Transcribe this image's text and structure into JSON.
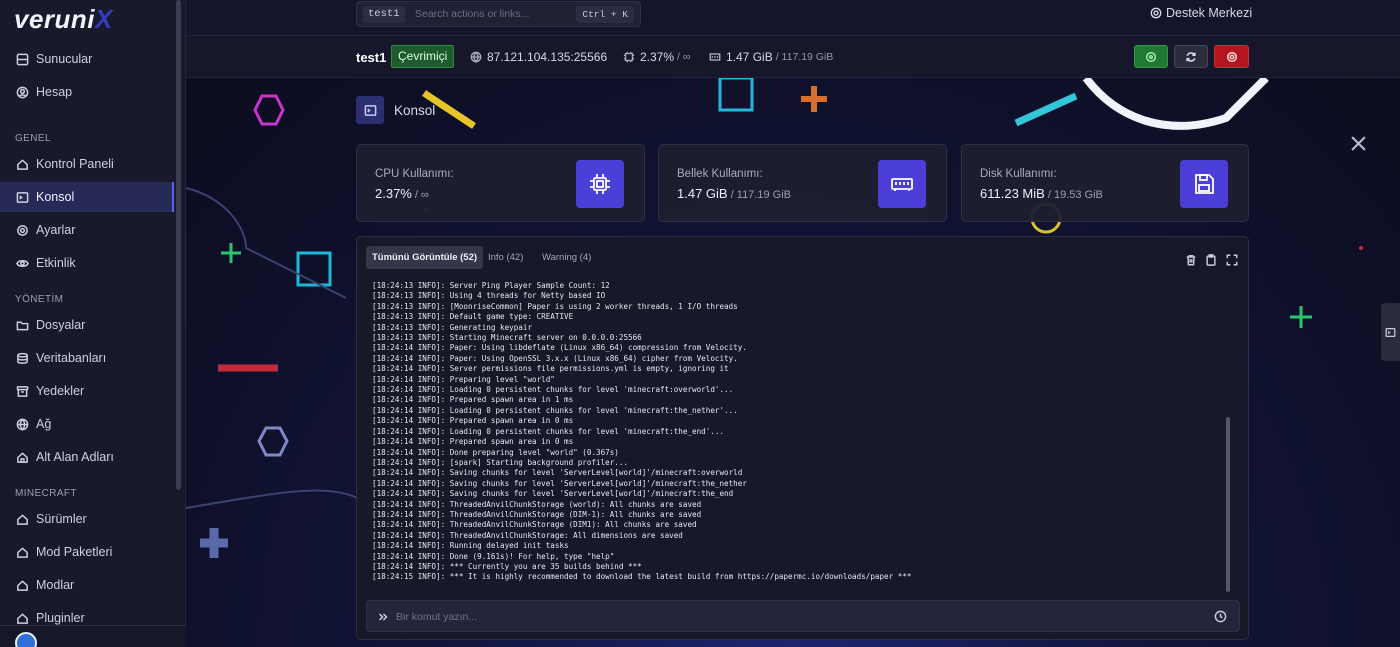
{
  "brand": {
    "name": "veruni",
    "suffix": "X"
  },
  "search": {
    "chip": "test1",
    "placeholder": "Search actions or links...",
    "shortcut": "Ctrl + K"
  },
  "help_link": "Destek Merkezi",
  "sidebar": {
    "top_items": [
      {
        "label": "Sunucular",
        "icon": "server-icon"
      },
      {
        "label": "Hesap",
        "icon": "account-icon"
      }
    ],
    "sections": [
      {
        "title": "GENEL",
        "items": [
          {
            "label": "Kontrol Paneli",
            "icon": "home-icon"
          },
          {
            "label": "Konsol",
            "icon": "terminal-icon",
            "active": true
          },
          {
            "label": "Ayarlar",
            "icon": "gear-icon"
          },
          {
            "label": "Etkinlik",
            "icon": "eye-icon"
          }
        ]
      },
      {
        "title": "YÖNETİM",
        "items": [
          {
            "label": "Dosyalar",
            "icon": "folder-icon"
          },
          {
            "label": "Veritabanları",
            "icon": "database-icon"
          },
          {
            "label": "Yedekler",
            "icon": "archive-icon"
          },
          {
            "label": "Ağ",
            "icon": "network-icon"
          },
          {
            "label": "Alt Alan Adları",
            "icon": "subdomain-icon"
          }
        ]
      },
      {
        "title": "MINECRAFT",
        "items": [
          {
            "label": "Sürümler",
            "icon": "versions-icon"
          },
          {
            "label": "Mod Paketleri",
            "icon": "modpack-icon"
          },
          {
            "label": "Modlar",
            "icon": "mods-icon"
          },
          {
            "label": "Pluginler",
            "icon": "plugins-icon"
          }
        ]
      }
    ]
  },
  "server": {
    "name": "test1",
    "status": "Çevrimiçi",
    "address": "87.121.104.135:25566",
    "cpu": "2.37%",
    "cpu_limit": "/ ∞",
    "memory": "1.47 GiB",
    "memory_limit": "/ 117.19 GiB"
  },
  "page": {
    "title": "Konsol"
  },
  "stats": [
    {
      "label": "CPU Kullanımı:",
      "value": "2.37%",
      "sub": " / ∞",
      "icon": "cpu-icon"
    },
    {
      "label": "Bellek Kullanımı:",
      "value": "1.47 GiB",
      "sub": " / 117.19 GiB",
      "icon": "memory-icon"
    },
    {
      "label": "Disk Kullanımı:",
      "value": "611.23 MiB",
      "sub": " / 19.53 GiB",
      "icon": "disk-icon"
    }
  ],
  "console": {
    "tabs": [
      {
        "label": "Tümünü Görüntüle (52)",
        "active": true
      },
      {
        "label": "Info (42)",
        "active": false
      },
      {
        "label": "Warning (4)",
        "active": false
      }
    ],
    "input_placeholder": "Bir komut yazın...",
    "lines": [
      "[18:24:13 INFO]: Server Ping Player Sample Count: 12",
      "[18:24:13 INFO]: Using 4 threads for Netty based IO",
      "[18:24:13 INFO]: [MoonriseCommon] Paper is using 2 worker threads, 1 I/O threads",
      "[18:24:13 INFO]: Default game type: CREATIVE",
      "[18:24:13 INFO]: Generating keypair",
      "[18:24:13 INFO]: Starting Minecraft server on 0.0.0.0:25566",
      "[18:24:14 INFO]: Paper: Using libdeflate (Linux x86_64) compression from Velocity.",
      "[18:24:14 INFO]: Paper: Using OpenSSL 3.x.x (Linux x86_64) cipher from Velocity.",
      "[18:24:14 INFO]: Server permissions file permissions.yml is empty, ignoring it",
      "[18:24:14 INFO]: Preparing level \"world\"",
      "[18:24:14 INFO]: Loading 0 persistent chunks for level 'minecraft:overworld'...",
      "[18:24:14 INFO]: Prepared spawn area in 1 ms",
      "[18:24:14 INFO]: Loading 0 persistent chunks for level 'minecraft:the_nether'...",
      "[18:24:14 INFO]: Prepared spawn area in 0 ms",
      "[18:24:14 INFO]: Loading 0 persistent chunks for level 'minecraft:the_end'...",
      "[18:24:14 INFO]: Prepared spawn area in 0 ms",
      "[18:24:14 INFO]: Done preparing level \"world\" (0.367s)",
      "[18:24:14 INFO]: [spark] Starting background profiler...",
      "[18:24:14 INFO]: Saving chunks for level 'ServerLevel[world]'/minecraft:overworld",
      "[18:24:14 INFO]: Saving chunks for level 'ServerLevel[world]'/minecraft:the_nether",
      "[18:24:14 INFO]: Saving chunks for level 'ServerLevel[world]'/minecraft:the_end",
      "[18:24:14 INFO]: ThreadedAnvilChunkStorage (world): All chunks are saved",
      "[18:24:14 INFO]: ThreadedAnvilChunkStorage (DIM-1): All chunks are saved",
      "[18:24:14 INFO]: ThreadedAnvilChunkStorage (DIM1): All chunks are saved",
      "[18:24:14 INFO]: ThreadedAnvilChunkStorage: All dimensions are saved",
      "[18:24:14 INFO]: Running delayed init tasks",
      "[18:24:14 INFO]: Done (9.161s)! For help, type \"help\"",
      "[18:24:14 INFO]: *** Currently you are 35 builds behind ***",
      "[18:24:15 INFO]: *** It is highly recommended to download the latest build from https://papermc.io/downloads/paper ***"
    ]
  },
  "colors": {
    "accent": "#4c3fd8",
    "online": "#1f5a2c",
    "danger": "#b3161e",
    "active_nav": "#272a57"
  }
}
